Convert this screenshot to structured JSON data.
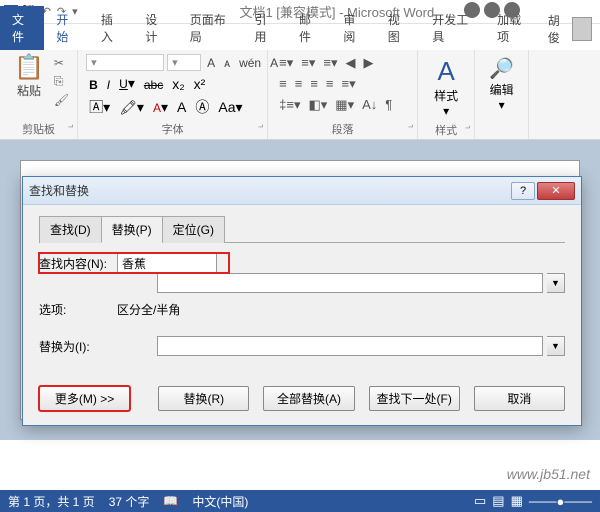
{
  "titlebar": {
    "doc_title": "文档1 [兼容模式] - Microsoft Word"
  },
  "tabs": {
    "file": "文件",
    "home": "开始",
    "insert": "插入",
    "design": "设计",
    "layout": "页面布局",
    "references": "引用",
    "mailings": "邮件",
    "review": "审阅",
    "view": "视图",
    "developer": "开发工具",
    "addins": "加载项",
    "user": "胡俊"
  },
  "ribbon": {
    "clipboard": {
      "label": "剪贴板",
      "paste": "粘贴"
    },
    "font": {
      "label": "字体"
    },
    "paragraph": {
      "label": "段落"
    },
    "styles": {
      "label": "样式",
      "btn": "样式"
    },
    "editing": {
      "label": "编辑",
      "btn": "编辑"
    }
  },
  "dialog": {
    "title": "查找和替换",
    "tabs": {
      "find": "查找(D)",
      "replace": "替换(P)",
      "goto": "定位(G)"
    },
    "find_label": "查找内容(N):",
    "find_value": "香蕉",
    "options_label": "选项:",
    "options_value": "区分全/半角",
    "replace_label": "替换为(I):",
    "replace_value": "",
    "buttons": {
      "more": "更多(M) >>",
      "replace": "替换(R)",
      "replace_all": "全部替换(A)",
      "find_next": "查找下一处(F)",
      "cancel": "取消"
    }
  },
  "statusbar": {
    "page": "第 1 页，共 1 页",
    "words": "37 个字",
    "lang": "中文(中国)"
  },
  "watermark": "www.jb51.net"
}
